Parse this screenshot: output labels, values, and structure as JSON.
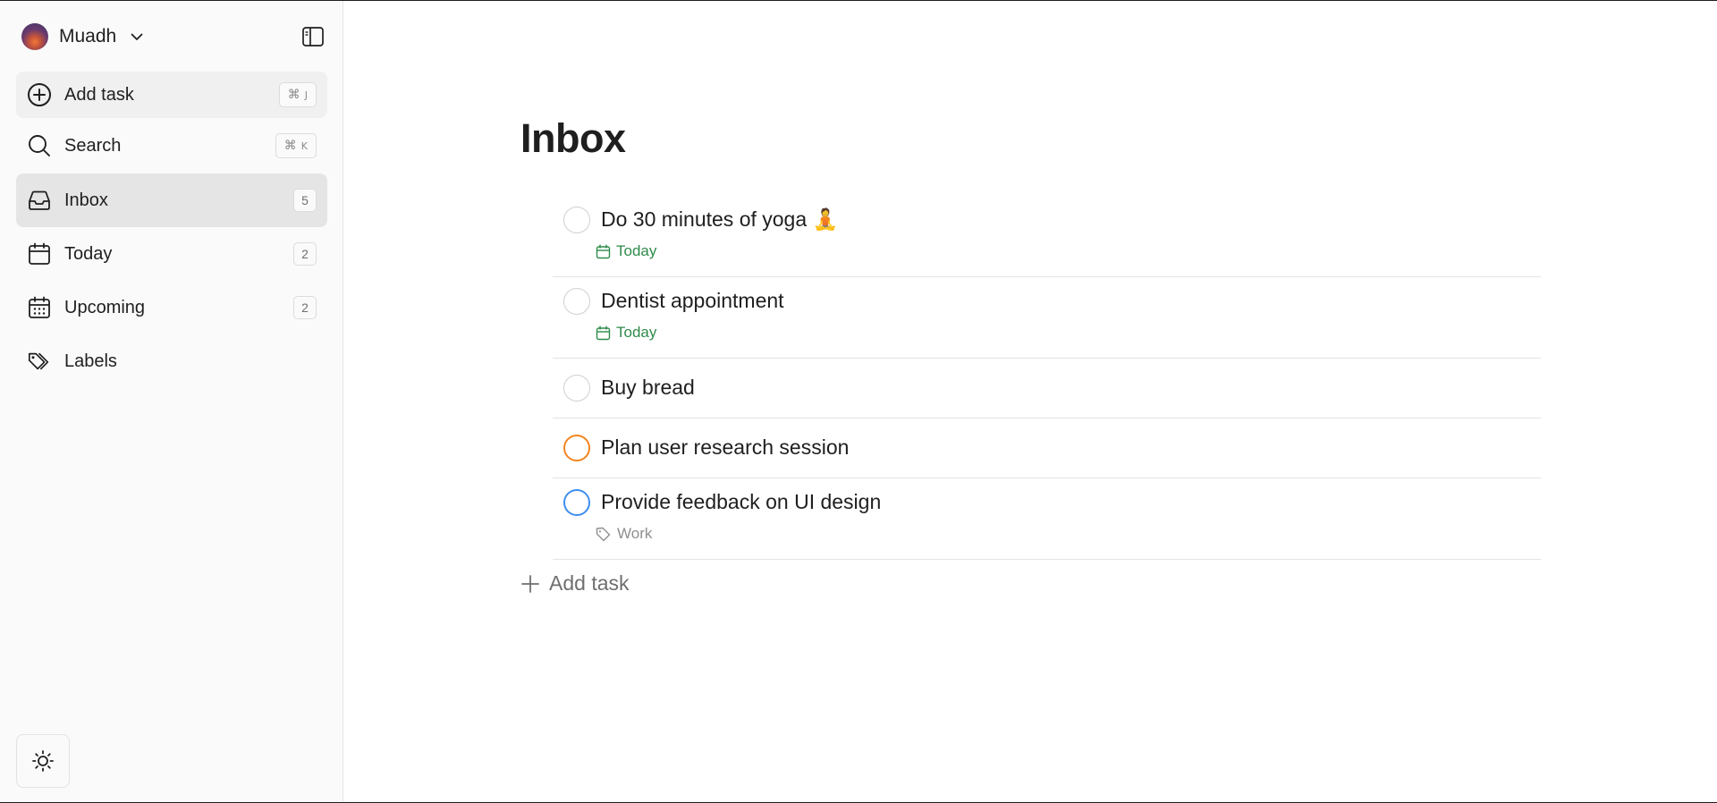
{
  "account": {
    "name": "Muadh"
  },
  "sidebar": {
    "add_task": {
      "label": "Add task",
      "shortcut_cmd": "⌘",
      "shortcut_key": "J"
    },
    "search": {
      "label": "Search",
      "shortcut_cmd": "⌘",
      "shortcut_key": "K"
    },
    "items": [
      {
        "label": "Inbox",
        "count": "5",
        "icon": "inbox-icon",
        "active": true
      },
      {
        "label": "Today",
        "count": "2",
        "icon": "calendar-icon"
      },
      {
        "label": "Upcoming",
        "count": "2",
        "icon": "calendar-grid-icon"
      },
      {
        "label": "Labels",
        "icon": "tags-icon"
      }
    ],
    "theme_icon": "sun-icon"
  },
  "main": {
    "title": "Inbox",
    "tasks": [
      {
        "title": "Do 30 minutes of yoga 🧘",
        "meta": "Today",
        "meta_type": "date",
        "priority_color": "#cfcfcf"
      },
      {
        "title": "Dentist appointment",
        "meta": "Today",
        "meta_type": "date",
        "priority_color": "#cfcfcf"
      },
      {
        "title": "Buy bread",
        "priority_color": "#cfcfcf"
      },
      {
        "title": "Plan user research session",
        "priority_color": "#f5841f"
      },
      {
        "title": "Provide feedback on UI design",
        "meta": "Work",
        "meta_type": "label",
        "priority_color": "#3e8ef0"
      }
    ],
    "add_task_label": "Add task"
  },
  "colors": {
    "date_green": "#2e8b4a",
    "priority_orange": "#f5841f",
    "priority_blue": "#3e8ef0",
    "sidebar_active": "#e5e5e5"
  }
}
